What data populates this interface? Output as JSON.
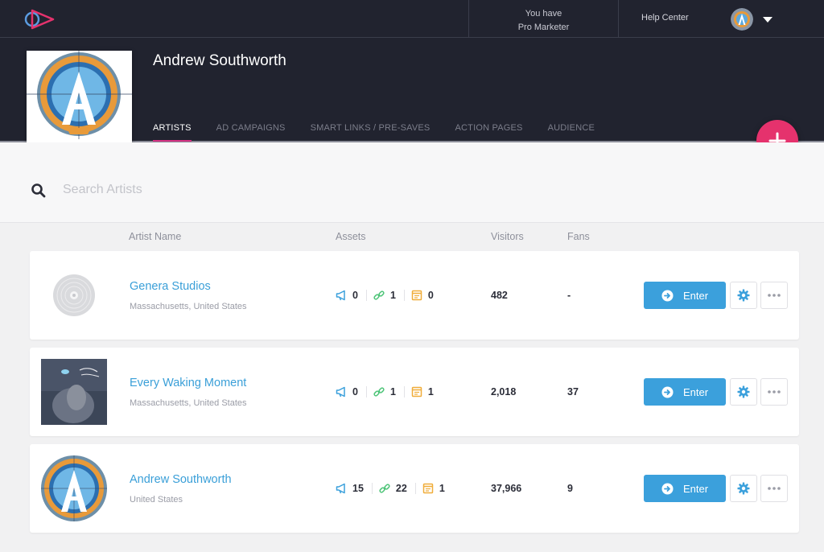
{
  "topbar": {
    "plan_line1": "You have",
    "plan_line2": "Pro Marketer",
    "help_label": "Help Center"
  },
  "profile": {
    "name": "Andrew Southworth"
  },
  "tabs": [
    {
      "label": "ARTISTS",
      "active": true
    },
    {
      "label": "AD CAMPAIGNS"
    },
    {
      "label": "SMART LINKS / PRE-SAVES"
    },
    {
      "label": "ACTION PAGES"
    },
    {
      "label": "AUDIENCE"
    }
  ],
  "search": {
    "placeholder": "Search Artists"
  },
  "columns": {
    "name": "Artist Name",
    "assets": "Assets",
    "visitors": "Visitors",
    "fans": "Fans"
  },
  "rows": [
    {
      "name": "Genera Studios",
      "location": "Massachusetts, United States",
      "ads": "0",
      "links": "1",
      "pages": "0",
      "visitors": "482",
      "fans": "-",
      "enter_label": "Enter"
    },
    {
      "name": "Every Waking Moment",
      "location": "Massachusetts, United States",
      "ads": "0",
      "links": "1",
      "pages": "1",
      "visitors": "2,018",
      "fans": "37",
      "enter_label": "Enter"
    },
    {
      "name": "Andrew Southworth",
      "location": "United States",
      "ads": "15",
      "links": "22",
      "pages": "1",
      "visitors": "37,966",
      "fans": "9",
      "enter_label": "Enter"
    }
  ],
  "colors": {
    "accent": "#3ba0dc",
    "brand_pink": "#e5326d",
    "header_bg": "#21232f"
  }
}
